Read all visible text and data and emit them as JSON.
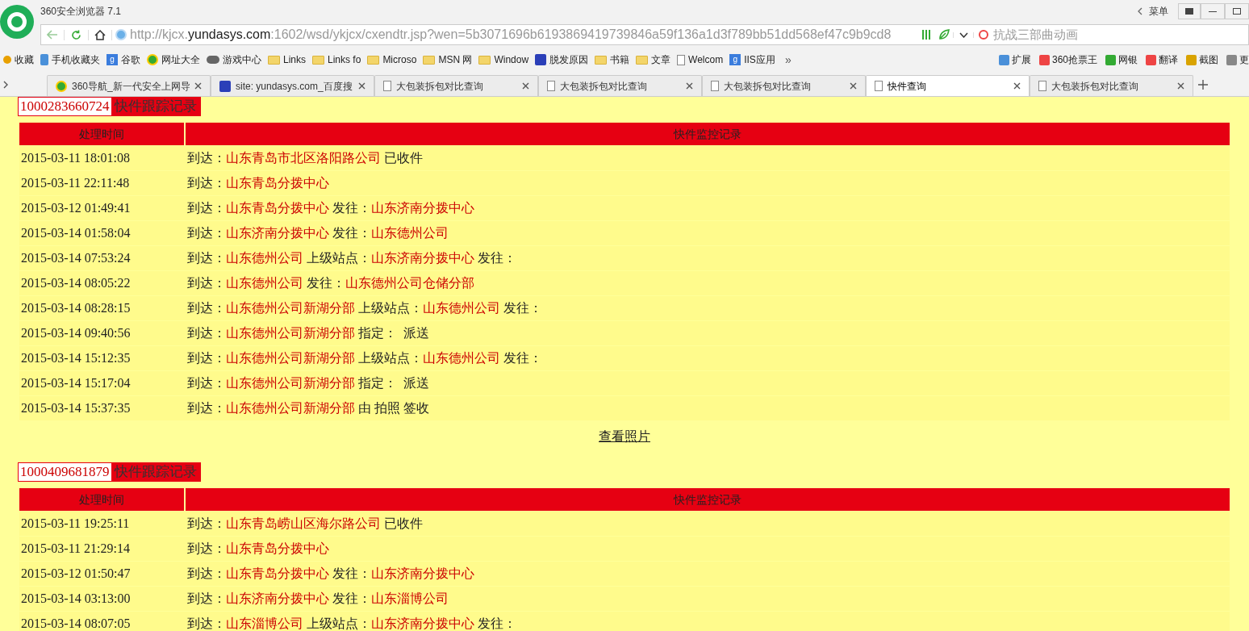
{
  "window": {
    "title": "360安全浏览器 7.1",
    "menu": "菜单"
  },
  "address_bar": {
    "url_scheme": "http://kjcx.",
    "url_host": "yundasys.com",
    "url_rest": ":1602/wsd/ykjcx/cxendtr.jsp?wen=5b3071696b6193869419739846a59f136a1d3f789bb51dd568ef47c9b9cd8",
    "search_placeholder": "抗战三部曲动画"
  },
  "bookmarks": [
    {
      "label": "收藏",
      "kind": "star"
    },
    {
      "label": "手机收藏夹",
      "kind": "phone"
    },
    {
      "label": "谷歌",
      "kind": "g"
    },
    {
      "label": "网址大全",
      "kind": "plus"
    },
    {
      "label": "游戏中心",
      "kind": "game"
    },
    {
      "label": "Links",
      "kind": "folder"
    },
    {
      "label": "Links fo",
      "kind": "folder"
    },
    {
      "label": "Microso",
      "kind": "folder"
    },
    {
      "label": "MSN 网",
      "kind": "folder"
    },
    {
      "label": "Window",
      "kind": "folder"
    },
    {
      "label": "脱发原因",
      "kind": "paw"
    },
    {
      "label": "书籍",
      "kind": "folder"
    },
    {
      "label": "文章",
      "kind": "folder"
    },
    {
      "label": "Welcom",
      "kind": "page"
    },
    {
      "label": "IIS应用",
      "kind": "g"
    },
    {
      "label": "»",
      "kind": "more"
    }
  ],
  "extensions": [
    "扩展",
    "360抢票王",
    "网银",
    "翻译",
    "截图",
    "更"
  ],
  "tabs": [
    {
      "label": "360导航_新一代安全上网导",
      "kind": "plus",
      "selected": false
    },
    {
      "label": "site: yundasys.com_百度搜",
      "kind": "paw",
      "selected": false
    },
    {
      "label": "大包装拆包对比查询",
      "kind": "page",
      "selected": false
    },
    {
      "label": "大包装拆包对比查询",
      "kind": "page",
      "selected": false
    },
    {
      "label": "大包装拆包对比查询",
      "kind": "page",
      "selected": false
    },
    {
      "label": "快件查询",
      "kind": "page",
      "selected": true
    },
    {
      "label": "大包装拆包对比查询",
      "kind": "page",
      "selected": false
    }
  ],
  "shipments": [
    {
      "number": "1000283660724",
      "title": "快件跟踪记录",
      "columns": [
        "处理时间",
        "快件监控记录"
      ],
      "link": "查看照片",
      "rows": [
        {
          "time": "2015-03-11 18:01:08",
          "record": [
            {
              "kind": "plain",
              "text": "到达："
            },
            {
              "kind": "place",
              "text": "山东青岛市北区洛阳路公司"
            },
            {
              "kind": "plain",
              "text": "已收件"
            }
          ]
        },
        {
          "time": "2015-03-11 22:11:48",
          "record": [
            {
              "kind": "plain",
              "text": "到达："
            },
            {
              "kind": "place",
              "text": "山东青岛分拨中心"
            }
          ]
        },
        {
          "time": "2015-03-12 01:49:41",
          "record": [
            {
              "kind": "plain",
              "text": "到达："
            },
            {
              "kind": "place",
              "text": "山东青岛分拨中心"
            },
            {
              "kind": "plain",
              "text": "发往："
            },
            {
              "kind": "place",
              "text": "山东济南分拨中心"
            }
          ]
        },
        {
          "time": "2015-03-14 01:58:04",
          "record": [
            {
              "kind": "plain",
              "text": "到达："
            },
            {
              "kind": "place",
              "text": "山东济南分拨中心"
            },
            {
              "kind": "plain",
              "text": "发往："
            },
            {
              "kind": "place",
              "text": "山东德州公司"
            }
          ]
        },
        {
          "time": "2015-03-14 07:53:24",
          "record": [
            {
              "kind": "plain",
              "text": "到达："
            },
            {
              "kind": "place",
              "text": "山东德州公司"
            },
            {
              "kind": "plain",
              "text": "上级站点："
            },
            {
              "kind": "place",
              "text": "山东济南分拨中心"
            },
            {
              "kind": "plain",
              "text": "发往："
            }
          ]
        },
        {
          "time": "2015-03-14 08:05:22",
          "record": [
            {
              "kind": "plain",
              "text": "到达："
            },
            {
              "kind": "place",
              "text": "山东德州公司"
            },
            {
              "kind": "plain",
              "text": "发往："
            },
            {
              "kind": "place",
              "text": "山东德州公司仓储分部"
            }
          ]
        },
        {
          "time": "2015-03-14 08:28:15",
          "record": [
            {
              "kind": "plain",
              "text": "到达："
            },
            {
              "kind": "place",
              "text": "山东德州公司新湖分部"
            },
            {
              "kind": "plain",
              "text": "上级站点："
            },
            {
              "kind": "place",
              "text": "山东德州公司"
            },
            {
              "kind": "plain",
              "text": "发往："
            }
          ]
        },
        {
          "time": "2015-03-14 09:40:56",
          "record": [
            {
              "kind": "plain",
              "text": "到达："
            },
            {
              "kind": "place",
              "text": "山东德州公司新湖分部"
            },
            {
              "kind": "plain",
              "text": "指定：  派送"
            }
          ]
        },
        {
          "time": "2015-03-14 15:12:35",
          "record": [
            {
              "kind": "plain",
              "text": "到达："
            },
            {
              "kind": "place",
              "text": "山东德州公司新湖分部"
            },
            {
              "kind": "plain",
              "text": "上级站点："
            },
            {
              "kind": "place",
              "text": "山东德州公司"
            },
            {
              "kind": "plain",
              "text": "发往："
            }
          ]
        },
        {
          "time": "2015-03-14 15:17:04",
          "record": [
            {
              "kind": "plain",
              "text": "到达："
            },
            {
              "kind": "place",
              "text": "山东德州公司新湖分部"
            },
            {
              "kind": "plain",
              "text": "指定：  派送"
            }
          ]
        },
        {
          "time": "2015-03-14 15:37:35",
          "record": [
            {
              "kind": "plain",
              "text": "到达："
            },
            {
              "kind": "place",
              "text": "山东德州公司新湖分部"
            },
            {
              "kind": "plain",
              "text": "由 拍照 签收"
            }
          ]
        }
      ]
    },
    {
      "number": "1000409681879",
      "title": "快件跟踪记录",
      "columns": [
        "处理时间",
        "快件监控记录"
      ],
      "rows": [
        {
          "time": "2015-03-11 19:25:11",
          "record": [
            {
              "kind": "plain",
              "text": "到达："
            },
            {
              "kind": "place",
              "text": "山东青岛崂山区海尔路公司"
            },
            {
              "kind": "plain",
              "text": "已收件"
            }
          ]
        },
        {
          "time": "2015-03-11 21:29:14",
          "record": [
            {
              "kind": "plain",
              "text": "到达："
            },
            {
              "kind": "place",
              "text": "山东青岛分拨中心"
            }
          ]
        },
        {
          "time": "2015-03-12 01:50:47",
          "record": [
            {
              "kind": "plain",
              "text": "到达："
            },
            {
              "kind": "place",
              "text": "山东青岛分拨中心"
            },
            {
              "kind": "plain",
              "text": "发往："
            },
            {
              "kind": "place",
              "text": "山东济南分拨中心"
            }
          ]
        },
        {
          "time": "2015-03-14 03:13:00",
          "record": [
            {
              "kind": "plain",
              "text": "到达："
            },
            {
              "kind": "place",
              "text": "山东济南分拨中心"
            },
            {
              "kind": "plain",
              "text": "发往："
            },
            {
              "kind": "place",
              "text": "山东淄博公司"
            }
          ]
        },
        {
          "time": "2015-03-14 08:07:05",
          "record": [
            {
              "kind": "plain",
              "text": "到达："
            },
            {
              "kind": "place",
              "text": "山东淄博公司"
            },
            {
              "kind": "plain",
              "text": "上级站点："
            },
            {
              "kind": "place",
              "text": "山东济南分拨中心"
            },
            {
              "kind": "plain",
              "text": "发往："
            }
          ]
        }
      ]
    }
  ]
}
